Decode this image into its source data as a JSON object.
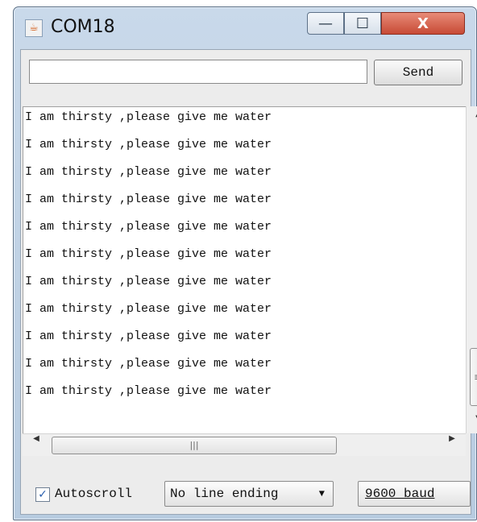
{
  "window": {
    "title": "COM18",
    "app_icon": "java-icon",
    "minimize": "—",
    "maximize": "☐",
    "close": "X"
  },
  "toolbar": {
    "input_value": "",
    "send_label": "Send"
  },
  "output": {
    "lines": [
      "I am thirsty ,please give me water",
      "I am thirsty ,please give me water",
      "I am thirsty ,please give me water",
      "I am thirsty ,please give me water",
      "I am thirsty ,please give me water",
      "I am thirsty ,please give me water",
      "I am thirsty ,please give me water",
      "I am thirsty ,please give me water",
      "I am thirsty ,please give me water",
      "I am thirsty ,please give me water",
      "I am thirsty ,please give me water"
    ]
  },
  "bottom": {
    "autoscroll_label": "Autoscroll",
    "autoscroll_checked": true,
    "line_ending": "No line ending",
    "baud": "9600 baud"
  }
}
